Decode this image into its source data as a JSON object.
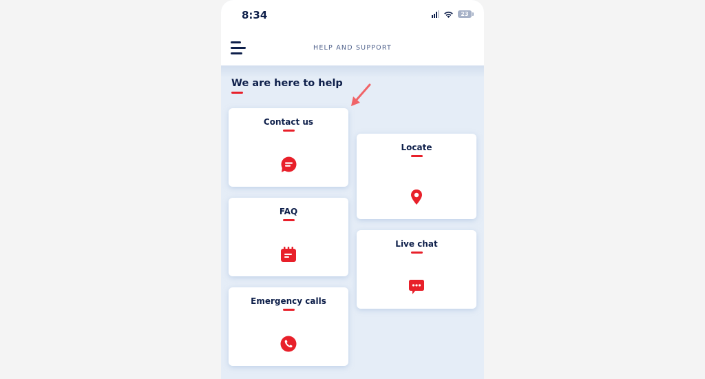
{
  "status_bar": {
    "time": "8:34",
    "battery": "23",
    "signal_icon": "cellular-signal-icon",
    "wifi_icon": "wifi-icon",
    "battery_icon": "battery-icon"
  },
  "header": {
    "title": "HELP AND SUPPORT",
    "menu_icon": "hamburger-menu-icon"
  },
  "main": {
    "heading": "We are here to help",
    "cards": [
      {
        "label": "Contact us",
        "icon": "chat-bubble-icon"
      },
      {
        "label": "Locate",
        "icon": "map-pin-icon"
      },
      {
        "label": "FAQ",
        "icon": "calendar-note-icon"
      },
      {
        "label": "Live chat",
        "icon": "chat-dots-icon"
      },
      {
        "label": "Emergency calls",
        "icon": "phone-icon"
      }
    ]
  },
  "colors": {
    "accent": "#e8202a",
    "navy": "#0e1f4a",
    "background": "#e5edf7",
    "annotation_arrow": "#f06468"
  }
}
